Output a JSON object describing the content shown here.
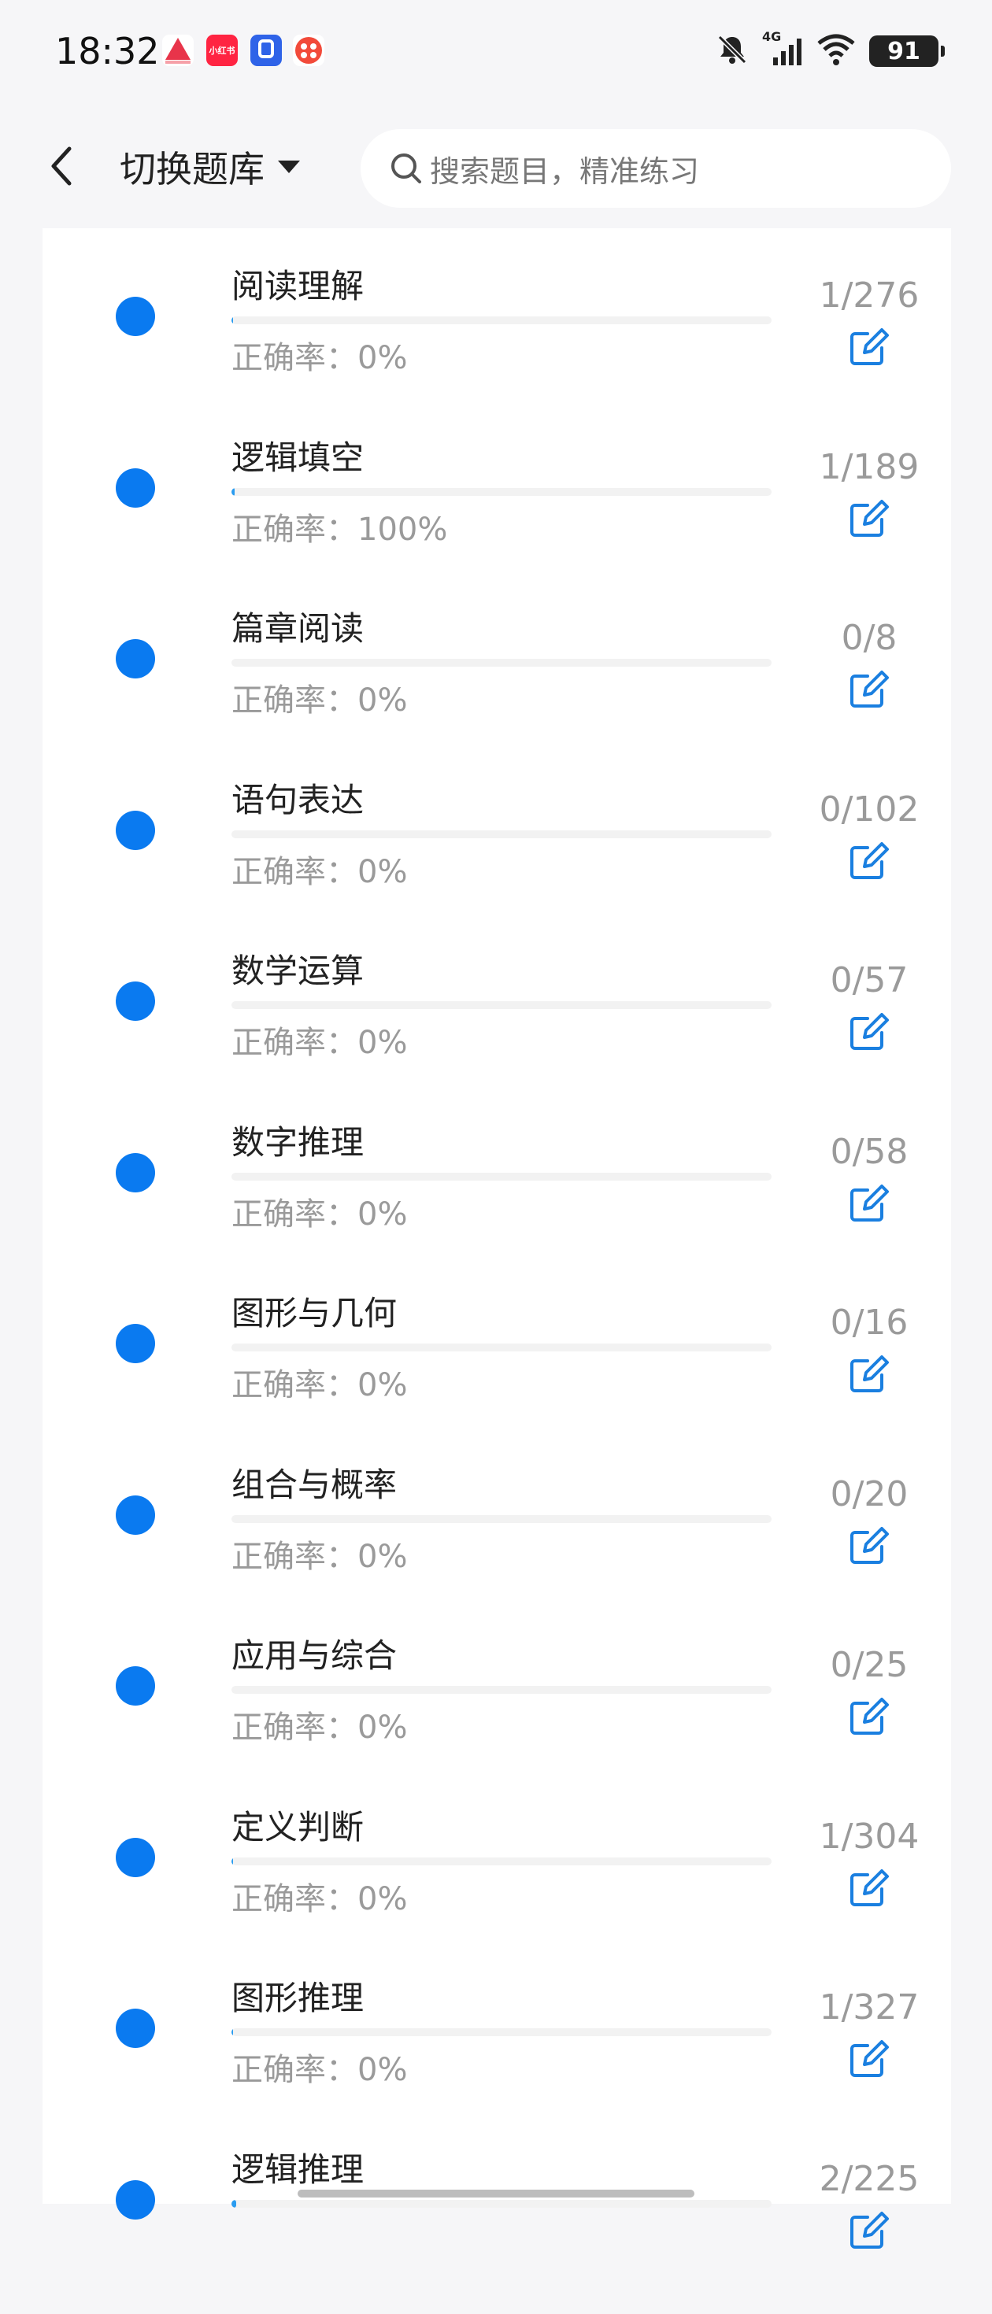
{
  "status_bar": {
    "time": "18:32",
    "signal_label": "4G",
    "battery": "91",
    "icons": [
      "app-icon-red-triangle",
      "app-icon-xiaohongshu",
      "app-icon-blue",
      "app-icon-red-dots",
      "bell-muted-icon",
      "signal-icon",
      "wifi-icon",
      "battery-icon"
    ],
    "app_badge_text": "小红书"
  },
  "header": {
    "bank_switch_label": "切换题库",
    "search_placeholder": "搜索题目，精准练习"
  },
  "colors": {
    "accent": "#0a7af0",
    "progress_fill": "#2a9cf0",
    "muted_text": "#9a9a9a",
    "edit_icon": "#1a7fe0"
  },
  "topics": [
    {
      "title": "阅读理解",
      "accuracy": "正确率：0%",
      "count": "1/276",
      "done": 1,
      "total": 276
    },
    {
      "title": "逻辑填空",
      "accuracy": "正确率：100%",
      "count": "1/189",
      "done": 1,
      "total": 189
    },
    {
      "title": "篇章阅读",
      "accuracy": "正确率：0%",
      "count": "0/8",
      "done": 0,
      "total": 8
    },
    {
      "title": "语句表达",
      "accuracy": "正确率：0%",
      "count": "0/102",
      "done": 0,
      "total": 102
    },
    {
      "title": "数学运算",
      "accuracy": "正确率：0%",
      "count": "0/57",
      "done": 0,
      "total": 57
    },
    {
      "title": "数字推理",
      "accuracy": "正确率：0%",
      "count": "0/58",
      "done": 0,
      "total": 58
    },
    {
      "title": "图形与几何",
      "accuracy": "正确率：0%",
      "count": "0/16",
      "done": 0,
      "total": 16
    },
    {
      "title": "组合与概率",
      "accuracy": "正确率：0%",
      "count": "0/20",
      "done": 0,
      "total": 20
    },
    {
      "title": "应用与综合",
      "accuracy": "正确率：0%",
      "count": "0/25",
      "done": 0,
      "total": 25
    },
    {
      "title": "定义判断",
      "accuracy": "正确率：0%",
      "count": "1/304",
      "done": 1,
      "total": 304
    },
    {
      "title": "图形推理",
      "accuracy": "正确率：0%",
      "count": "1/327",
      "done": 1,
      "total": 327
    },
    {
      "title": "逻辑推理",
      "accuracy": "",
      "count": "2/225",
      "done": 2,
      "total": 225
    }
  ]
}
